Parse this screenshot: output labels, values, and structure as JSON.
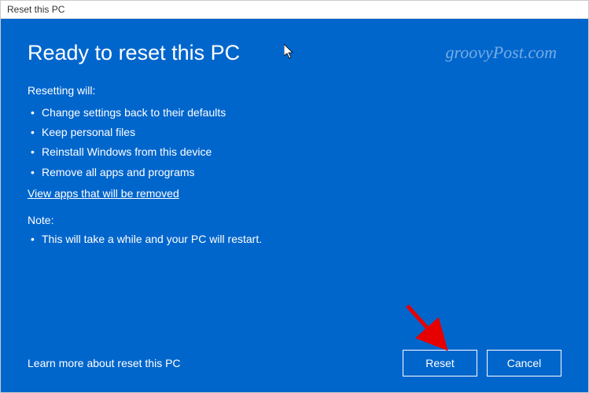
{
  "window": {
    "title": "Reset this PC"
  },
  "main": {
    "heading": "Ready to reset this PC",
    "resetting_label": "Resetting will:",
    "resetting_items": [
      "Change settings back to their defaults",
      "Keep personal files",
      "Reinstall Windows from this device",
      "Remove all apps and programs"
    ],
    "view_apps_link": "View apps that will be removed",
    "note_label": "Note:",
    "note_items": [
      "This will take a while and your PC will restart."
    ]
  },
  "footer": {
    "learn_more": "Learn more about reset this PC",
    "reset_label": "Reset",
    "cancel_label": "Cancel"
  },
  "watermark": "groovyPost.com"
}
